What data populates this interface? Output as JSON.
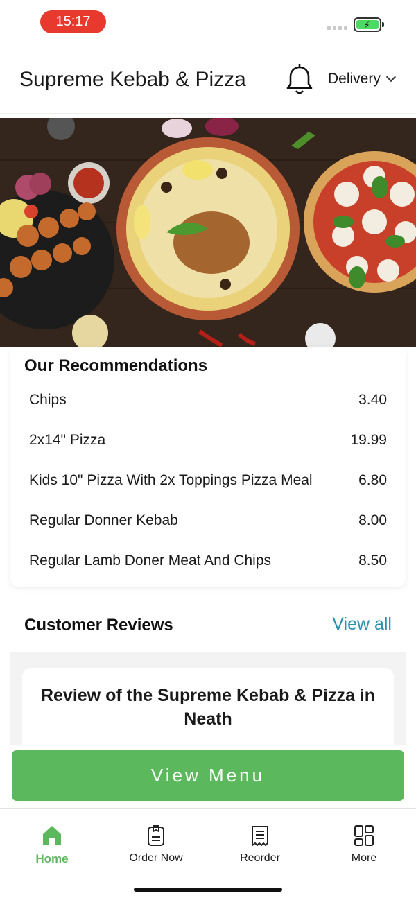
{
  "status_bar": {
    "time": "15:17"
  },
  "header": {
    "restaurant_name": "Supreme Kebab & Pizza",
    "delivery_label": "Delivery"
  },
  "recommendations": {
    "title": "Our Recommendations",
    "items": [
      {
        "name": "Chips",
        "price": "3.40"
      },
      {
        "name": "2x14\" Pizza",
        "price": "19.99"
      },
      {
        "name": "Kids 10\" Pizza With 2x Toppings Pizza Meal",
        "price": "6.80"
      },
      {
        "name": "Regular Donner Kebab",
        "price": "8.00"
      },
      {
        "name": "Regular Lamb Doner Meat And Chips",
        "price": "8.50"
      }
    ]
  },
  "reviews": {
    "title": "Customer Reviews",
    "view_all_label": "View all",
    "review_heading": "Review of the Supreme Kebab & Pizza in Neath"
  },
  "view_menu_label": "View Menu",
  "tabs": [
    {
      "label": "Home",
      "icon": "home-icon",
      "active": true
    },
    {
      "label": "Order Now",
      "icon": "order-icon",
      "active": false
    },
    {
      "label": "Reorder",
      "icon": "receipt-icon",
      "active": false
    },
    {
      "label": "More",
      "icon": "grid-icon",
      "active": false
    }
  ],
  "colors": {
    "accent_green": "#5cb85c",
    "link_blue": "#2b8fae",
    "time_pill": "#e8392f"
  }
}
